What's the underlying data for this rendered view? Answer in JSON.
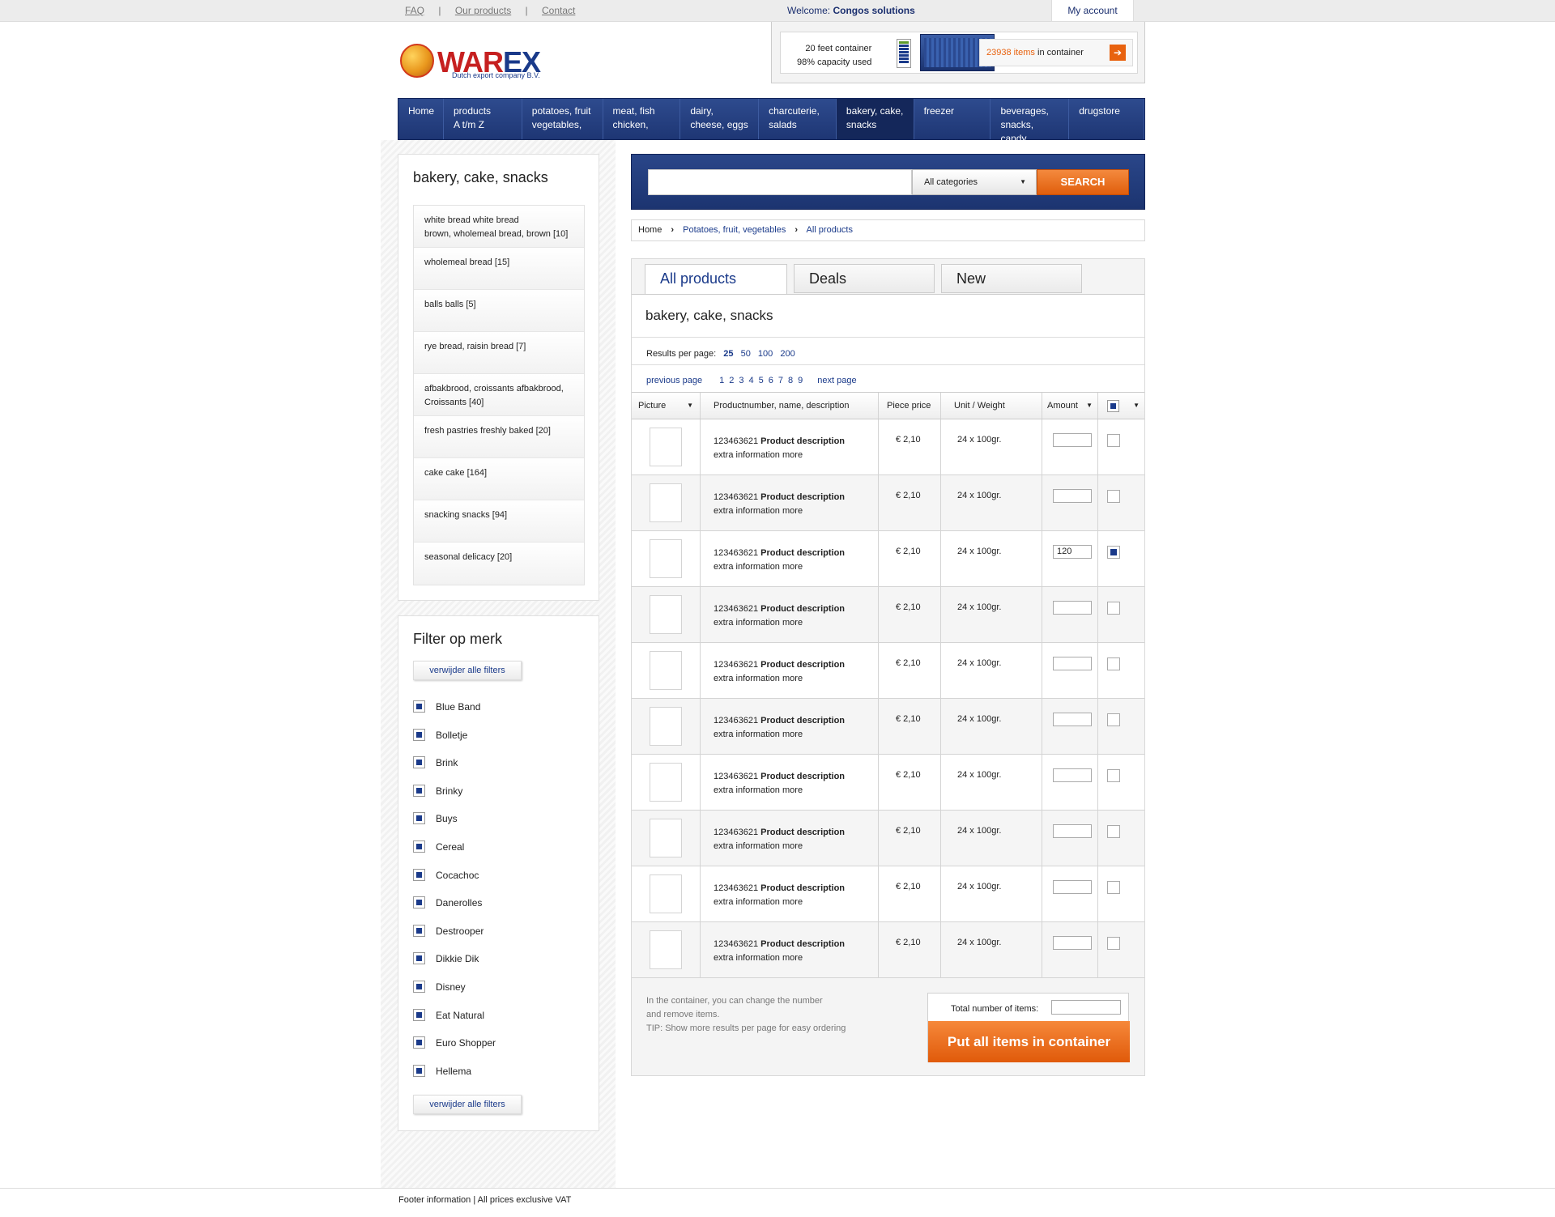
{
  "topbar": {
    "links": [
      "FAQ",
      "Our products",
      "Contact"
    ],
    "separator": "|",
    "welcome_prefix": "Welcome:",
    "welcome_name": "Congos solutions",
    "account": "My account"
  },
  "logo": {
    "brand_red": "WAR",
    "brand_blue": "EX",
    "tagline": "Dutch export company B.V."
  },
  "container": {
    "type_label": "20 feet container",
    "capacity": "98% capacity used",
    "capacity_fraction": 0.98,
    "count": "23938 items",
    "count_suffix": "in container"
  },
  "nav": [
    {
      "line1": "Home",
      "line2": ""
    },
    {
      "line1": "products",
      "line2": "A t/m Z"
    },
    {
      "line1": "potatoes, fruit",
      "line2": "vegetables,"
    },
    {
      "line1": "meat, fish",
      "line2": "chicken,"
    },
    {
      "line1": "dairy,",
      "line2": "cheese, eggs"
    },
    {
      "line1": "charcuterie,",
      "line2": "salads"
    },
    {
      "line1": "bakery, cake,",
      "line2": "snacks"
    },
    {
      "line1": "freezer",
      "line2": ""
    },
    {
      "line1": "beverages,",
      "line2": "snacks, candy"
    },
    {
      "line1": "drugstore",
      "line2": ""
    }
  ],
  "sidebar": {
    "title": "bakery, cake, snacks",
    "categories": [
      {
        "l1": "white bread white bread",
        "l2": "brown, wholemeal bread, brown [10]"
      },
      {
        "l1": "wholemeal bread [15]",
        "l2": ""
      },
      {
        "l1": "balls balls [5]",
        "l2": ""
      },
      {
        "l1": "rye bread, raisin bread [7]",
        "l2": ""
      },
      {
        "l1": "afbakbrood, croissants afbakbrood,",
        "l2": "Croissants [40]"
      },
      {
        "l1": "fresh pastries freshly baked [20]",
        "l2": ""
      },
      {
        "l1": "cake cake [164]",
        "l2": ""
      },
      {
        "l1": "snacking snacks [94]",
        "l2": ""
      },
      {
        "l1": "seasonal delicacy [20]",
        "l2": ""
      }
    ],
    "filter_title": "Filter op merk",
    "remove_filters": "verwijder alle filters",
    "brands": [
      "Blue Band",
      "Bolletje",
      "Brink",
      "Brinky",
      "Buys",
      "Cereal",
      "Cocachoc",
      "Danerolles",
      "Destrooper",
      "Dikkie Dik",
      "Disney",
      "Eat Natural",
      "Euro Shopper",
      "Hellema"
    ]
  },
  "search": {
    "placeholder": "",
    "category": "All categories",
    "button": "SEARCH"
  },
  "breadcrumb": {
    "home": "Home",
    "level1": "Potatoes, fruit, vegetables",
    "level2": "All products"
  },
  "tabs": [
    "All products",
    "Deals",
    "New"
  ],
  "listing": {
    "title": "bakery, cake, snacks",
    "results_label": "Results per page:",
    "per_page": [
      "25",
      "50",
      "100",
      "200"
    ],
    "previous": "previous page",
    "pages": [
      "1",
      "2",
      "3",
      "4",
      "5",
      "6",
      "7",
      "8",
      "9"
    ],
    "next": "next page",
    "headers": {
      "picture": "Picture",
      "product": "Productnumber, name, description",
      "price": "Piece price",
      "unit": "Unit / Weight",
      "amount": "Amount"
    },
    "rows": [
      {
        "number": "123463621",
        "name": "Product description",
        "extra": "extra information",
        "more": "more",
        "price": "€ 2,10",
        "unit": "24 x 100gr.",
        "amount": "",
        "checked": false
      },
      {
        "number": "123463621",
        "name": "Product description",
        "extra": "extra information",
        "more": "more",
        "price": "€ 2,10",
        "unit": "24 x 100gr.",
        "amount": "",
        "checked": false
      },
      {
        "number": "123463621",
        "name": "Product description",
        "extra": "extra information",
        "more": "more",
        "price": "€ 2,10",
        "unit": "24 x 100gr.",
        "amount": "120",
        "checked": true
      },
      {
        "number": "123463621",
        "name": "Product description",
        "extra": "extra information",
        "more": "more",
        "price": "€ 2,10",
        "unit": "24 x 100gr.",
        "amount": "",
        "checked": false
      },
      {
        "number": "123463621",
        "name": "Product description",
        "extra": "extra information",
        "more": "more",
        "price": "€ 2,10",
        "unit": "24 x 100gr.",
        "amount": "",
        "checked": false
      },
      {
        "number": "123463621",
        "name": "Product description",
        "extra": "extra information",
        "more": "more",
        "price": "€ 2,10",
        "unit": "24 x 100gr.",
        "amount": "",
        "checked": false
      },
      {
        "number": "123463621",
        "name": "Product description",
        "extra": "extra information",
        "more": "more",
        "price": "€ 2,10",
        "unit": "24 x 100gr.",
        "amount": "",
        "checked": false
      },
      {
        "number": "123463621",
        "name": "Product description",
        "extra": "extra information",
        "more": "more",
        "price": "€ 2,10",
        "unit": "24 x 100gr.",
        "amount": "",
        "checked": false
      },
      {
        "number": "123463621",
        "name": "Product description",
        "extra": "extra information",
        "more": "more",
        "price": "€ 2,10",
        "unit": "24 x 100gr.",
        "amount": "",
        "checked": false
      },
      {
        "number": "123463621",
        "name": "Product description",
        "extra": "extra information",
        "more": "more",
        "price": "€ 2,10",
        "unit": "24 x 100gr.",
        "amount": "",
        "checked": false
      }
    ],
    "tip_lines": [
      "In the container, you can change the number",
      "and remove items.",
      "TIP: Show more results per page for easy ordering"
    ],
    "total_label": "Total number of items:",
    "total_value": "",
    "put_button": "Put all items in container"
  },
  "footer": "Footer information | All prices exclusive VAT",
  "colors": {
    "navy": "#1e3674",
    "orange": "#e8620f",
    "link": "#1a3a8a"
  }
}
